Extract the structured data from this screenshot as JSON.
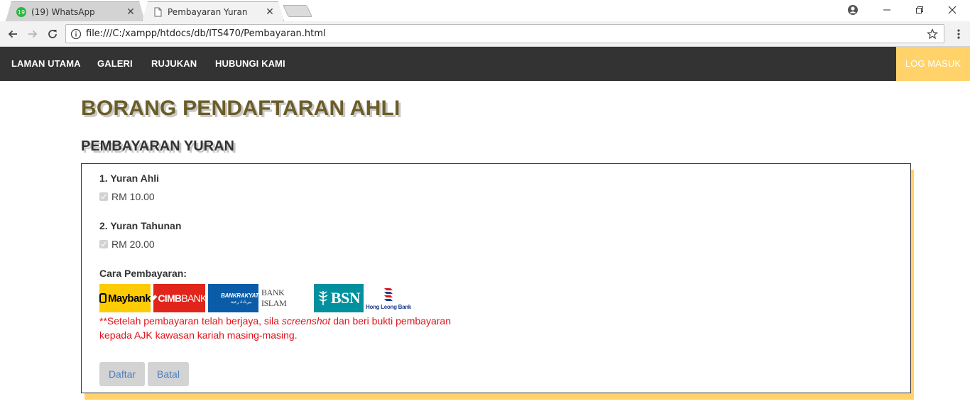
{
  "browser": {
    "tabs": [
      {
        "title": "(19) WhatsApp",
        "badge": "19",
        "active": false
      },
      {
        "title": "Pembayaran Yuran",
        "active": true
      }
    ],
    "address": "file:///C:/xampp/htdocs/db/ITS470/Pembayaran.html"
  },
  "nav": {
    "items": [
      "LAMAN UTAMA",
      "GALERI",
      "RUJUKAN",
      "HUBUNGI KAMI"
    ],
    "login": "LOG MASUK"
  },
  "page": {
    "title": "BORANG PENDAFTARAN AHLI",
    "subtitle": "PEMBAYARAN YURAN"
  },
  "form": {
    "fee1_label": "1. Yuran Ahli",
    "fee1_value": "RM 10.00",
    "fee2_label": "2. Yuran Tahunan",
    "fee2_value": "RM 20.00",
    "payment_label": "Cara Pembayaran:",
    "banks": {
      "maybank": "Maybank",
      "cimb_a": "CIMB",
      "cimb_b": "BANK",
      "rakyat_a": "BANKRAKYAT",
      "islam": "BANK ISLAM",
      "bsn": "BSN",
      "hongleong": "Hong Leong Bank"
    },
    "note_part1": "**Setelah pembayaran telah berjaya, sila ",
    "note_italic": "screenshot",
    "note_part2": " dan beri bukti pembayaran kepada AJK kawasan kariah masing-masing.",
    "submit_label": "Daftar",
    "cancel_label": "Batal"
  },
  "colors": {
    "nav_bg": "#333333",
    "login_bg": "#ffd36a",
    "title": "#6b5d28",
    "accent_shadow": "#ffd36a",
    "note": "#e0121b",
    "button_text": "#4a7fbf"
  }
}
